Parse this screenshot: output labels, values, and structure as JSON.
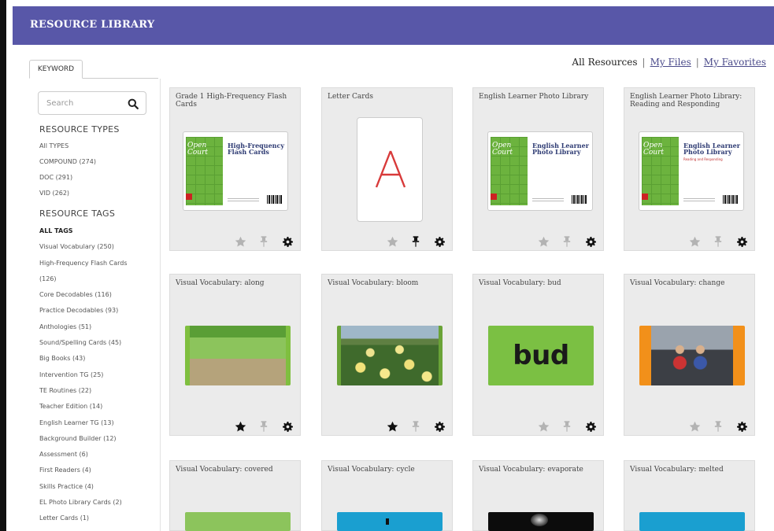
{
  "header": {
    "title": "RESOURCE LIBRARY"
  },
  "tabs": {
    "keyword": "KEYWORD"
  },
  "top_links": {
    "all": "All Resources",
    "separator": "|",
    "my_files": "My Files",
    "my_favorites": "My Favorites"
  },
  "search": {
    "placeholder": "Search",
    "value": "",
    "icon": "search-icon"
  },
  "resource_types": {
    "title": "RESOURCE TYPES",
    "items": [
      "All TYPES",
      "COMPOUND (274)",
      "DOC (291)",
      "VID (262)"
    ]
  },
  "resource_tags": {
    "title": "RESOURCE TAGS",
    "items": [
      "ALL TAGS",
      "Visual Vocabulary (250)",
      "High-Frequency Flash Cards",
      "(126)",
      "Core Decodables (116)",
      "Practice Decodables (93)",
      "Anthologies (51)",
      "Sound/Spelling Cards (45)",
      "Big Books (43)",
      "Intervention TG (25)",
      "TE Routines (22)",
      "Teacher Edition (14)",
      "English Learner TG (13)",
      "Background Builder (12)",
      "Assessment (6)",
      "First Readers (4)",
      "Skills Practice (4)",
      "EL Photo Library Cards (2)",
      "Letter Cards (1)"
    ]
  },
  "cards": [
    {
      "title": "Grade 1 High-Frequency Flash Cards",
      "thumb": {
        "logo1": "Open",
        "logo2": "Court",
        "title1": "High-Frequency",
        "title2": "Flash Cards",
        "sub": ""
      },
      "favorited": false,
      "pinned": false
    },
    {
      "title": "Letter Cards",
      "thumb": {
        "letter": "A"
      },
      "favorited": false,
      "pinned": true
    },
    {
      "title": "English Learner Photo Library",
      "thumb": {
        "logo1": "Open",
        "logo2": "Court",
        "title1": "English Learner",
        "title2": "Photo Library",
        "sub": ""
      },
      "favorited": false,
      "pinned": false
    },
    {
      "title": "English Learner Photo Library: Reading and Responding",
      "thumb": {
        "logo1": "Open",
        "logo2": "Court",
        "title1": "English Learner",
        "title2": "Photo Library",
        "sub": "Reading and Responding"
      },
      "favorited": false,
      "pinned": false
    },
    {
      "title": "Visual Vocabulary: along",
      "favorited": true,
      "pinned": false
    },
    {
      "title": "Visual Vocabulary: bloom",
      "favorited": true,
      "pinned": false
    },
    {
      "title": "Visual Vocabulary: bud",
      "thumb": {
        "word": "bud"
      },
      "favorited": false,
      "pinned": false
    },
    {
      "title": "Visual Vocabulary: change",
      "favorited": false,
      "pinned": false
    },
    {
      "title": "Visual Vocabulary: covered"
    },
    {
      "title": "Visual Vocabulary: cycle"
    },
    {
      "title": "Visual Vocabulary: evaporate"
    },
    {
      "title": "Visual Vocabulary: melted"
    }
  ],
  "colors": {
    "header_bg": "#5857a8",
    "card_bg": "#ebebeb",
    "icon_inactive": "#b3b3b3",
    "icon_active": "#111111",
    "link": "#4a4a8a"
  },
  "icons": {
    "favorite": "star-icon",
    "pin": "pin-icon",
    "settings": "gear-icon"
  }
}
